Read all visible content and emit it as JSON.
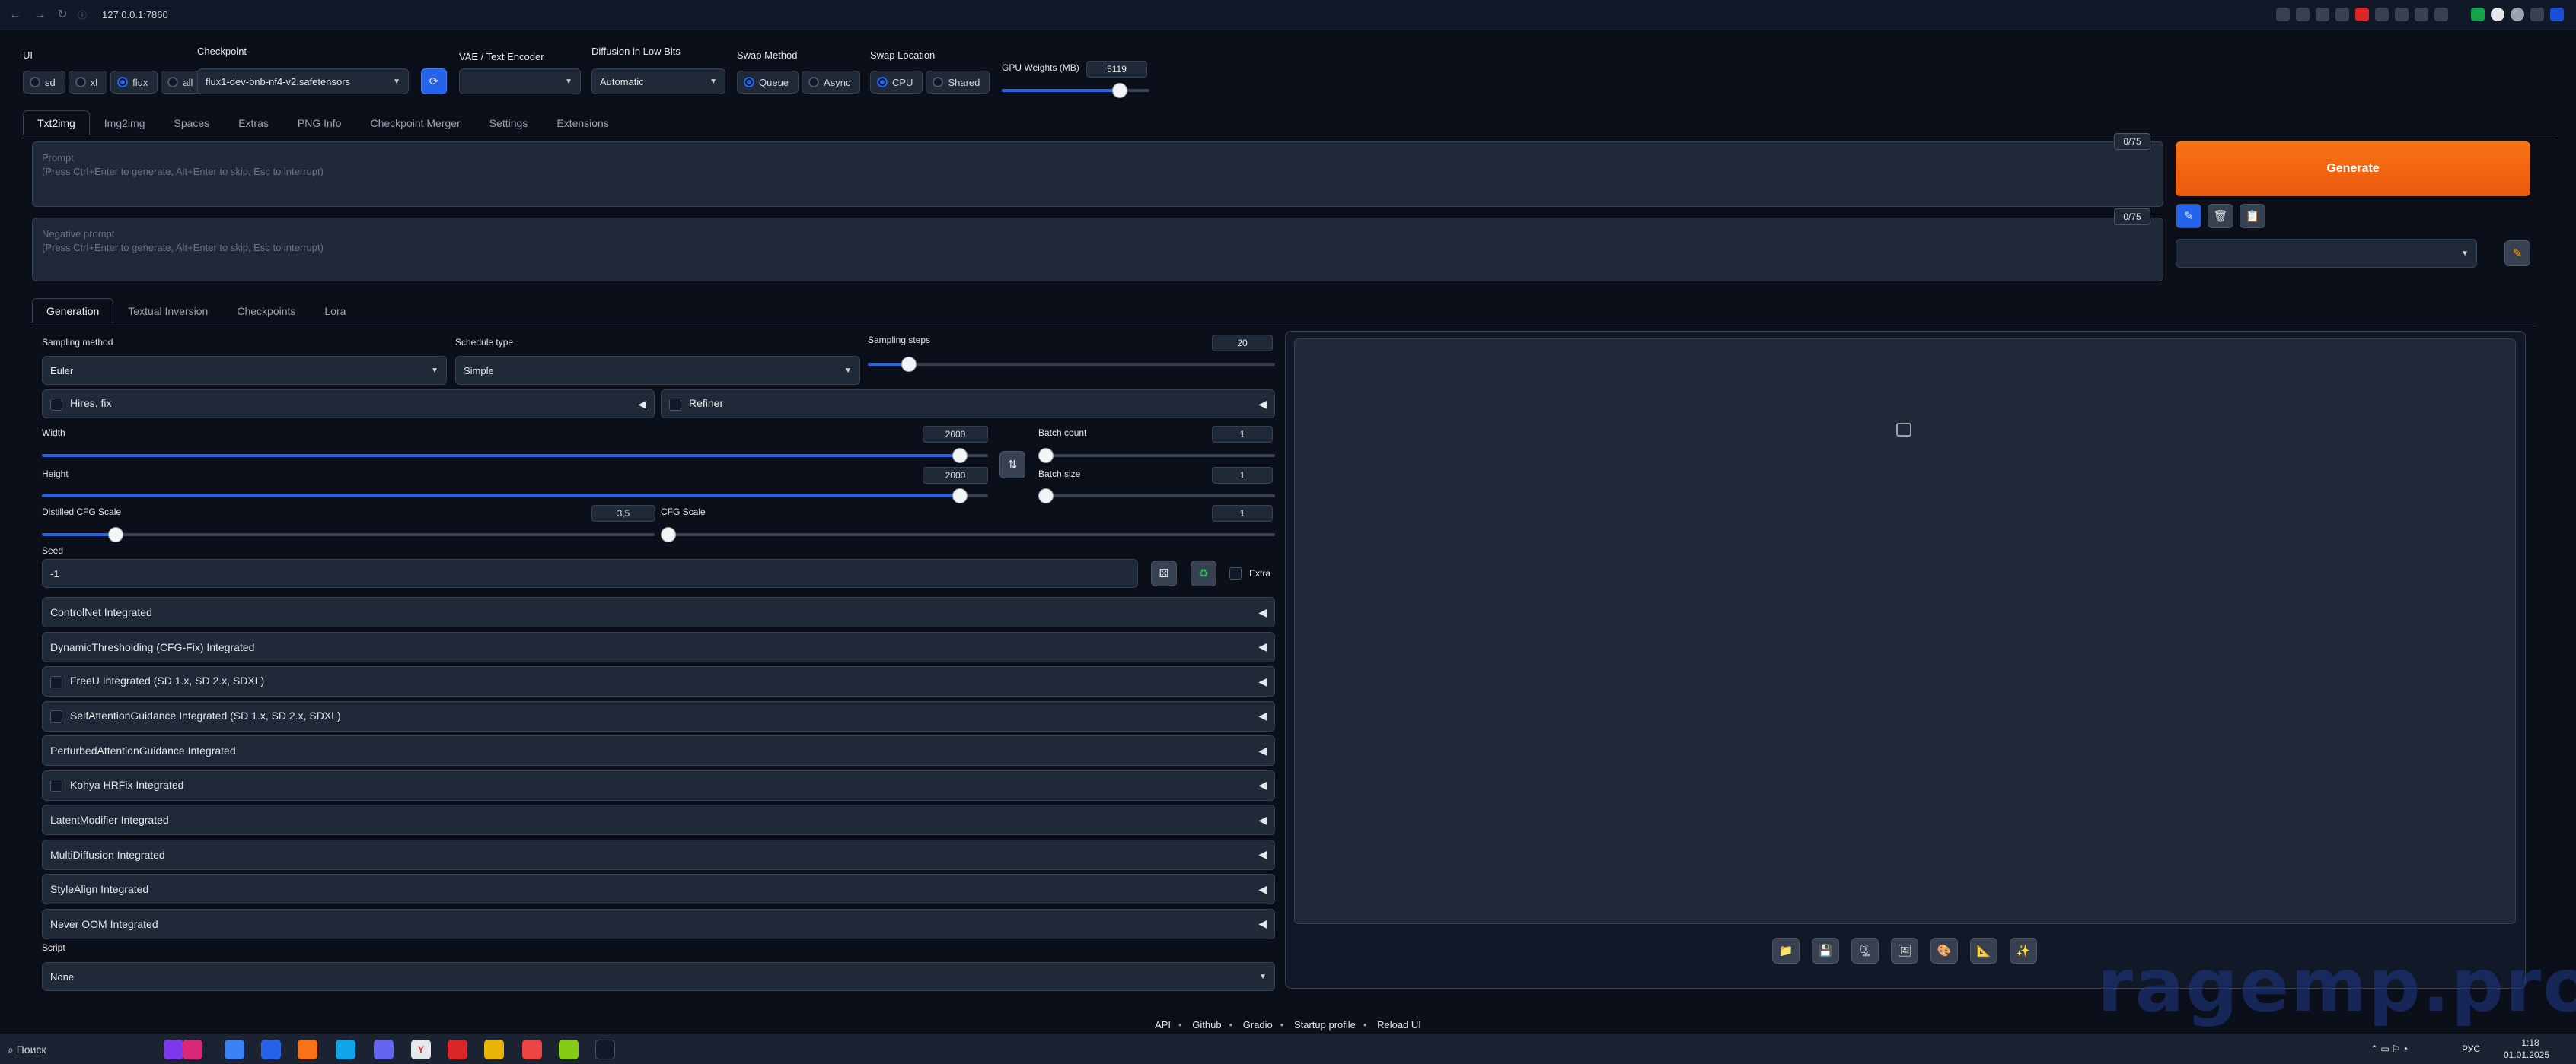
{
  "browser": {
    "url": "127.0.0.1:7860"
  },
  "top": {
    "ui_label": "UI",
    "ui_options": [
      "sd",
      "xl",
      "flux",
      "all"
    ],
    "ui_selected": "flux",
    "checkpoint_label": "Checkpoint",
    "checkpoint_value": "flux1-dev-bnb-nf4-v2.safetensors",
    "vae_label": "VAE / Text Encoder",
    "vae_value": "",
    "diffusion_label": "Diffusion in Low Bits",
    "diffusion_value": "Automatic",
    "swap_method_label": "Swap Method",
    "swap_method_options": [
      "Queue",
      "Async"
    ],
    "swap_method_selected": "Queue",
    "swap_location_label": "Swap Location",
    "swap_location_options": [
      "CPU",
      "Shared"
    ],
    "swap_location_selected": "CPU",
    "gpu_label": "GPU Weights (MB)",
    "gpu_value": "5119"
  },
  "main_tabs": [
    "Txt2img",
    "Img2img",
    "Spaces",
    "Extras",
    "PNG Info",
    "Checkpoint Merger",
    "Settings",
    "Extensions"
  ],
  "prompt": {
    "label": "Prompt",
    "hint": "(Press Ctrl+Enter to generate, Alt+Enter to skip, Esc to interrupt)",
    "counter": "0/75"
  },
  "negative": {
    "label": "Negative prompt",
    "hint": "(Press Ctrl+Enter to generate, Alt+Enter to skip, Esc to interrupt)",
    "counter": "0/75"
  },
  "generate_label": "Generate",
  "sub_tabs": [
    "Generation",
    "Textual Inversion",
    "Checkpoints",
    "Lora"
  ],
  "gen": {
    "sampling_method_label": "Sampling method",
    "sampling_method_value": "Euler",
    "schedule_type_label": "Schedule type",
    "schedule_type_value": "Simple",
    "sampling_steps_label": "Sampling steps",
    "sampling_steps_value": "20",
    "hires_label": "Hires. fix",
    "refiner_label": "Refiner",
    "width_label": "Width",
    "width_value": "2000",
    "height_label": "Height",
    "height_value": "2000",
    "batch_count_label": "Batch count",
    "batch_count_value": "1",
    "batch_size_label": "Batch size",
    "batch_size_value": "1",
    "distilled_cfg_label": "Distilled CFG Scale",
    "distilled_cfg_value": "3,5",
    "cfg_label": "CFG Scale",
    "cfg_value": "1",
    "seed_label": "Seed",
    "seed_value": "-1",
    "extra_label": "Extra"
  },
  "sliders": {
    "sampling_steps": 0.1,
    "width": 0.97,
    "height": 0.97,
    "batch_count": 0.0,
    "batch_size": 0.0,
    "distilled_cfg": 0.12,
    "cfg": 0.0,
    "gpu_weights": 0.8
  },
  "accordions": [
    {
      "label": "ControlNet Integrated",
      "checkbox": false
    },
    {
      "label": "DynamicThresholding (CFG-Fix) Integrated",
      "checkbox": false
    },
    {
      "label": "FreeU Integrated (SD 1.x, SD 2.x, SDXL)",
      "checkbox": true
    },
    {
      "label": "SelfAttentionGuidance Integrated (SD 1.x, SD 2.x, SDXL)",
      "checkbox": true
    },
    {
      "label": "PerturbedAttentionGuidance Integrated",
      "checkbox": false
    },
    {
      "label": "Kohya HRFix Integrated",
      "checkbox": true
    },
    {
      "label": "LatentModifier Integrated",
      "checkbox": false
    },
    {
      "label": "MultiDiffusion Integrated",
      "checkbox": false
    },
    {
      "label": "StyleAlign Integrated",
      "checkbox": false
    },
    {
      "label": "Never OOM Integrated",
      "checkbox": false
    }
  ],
  "script_label": "Script",
  "script_value": "None",
  "footer": [
    "API",
    "Github",
    "Gradio",
    "Startup profile",
    "Reload UI"
  ],
  "watermark": "ragemp.pro",
  "taskbar": {
    "search": "Поиск",
    "lang": "РУС",
    "time": "1:18",
    "date": "01.01.2025"
  },
  "colors": {
    "accent": "#2563eb",
    "generate": "#f97316",
    "bg": "#0b0f19"
  }
}
